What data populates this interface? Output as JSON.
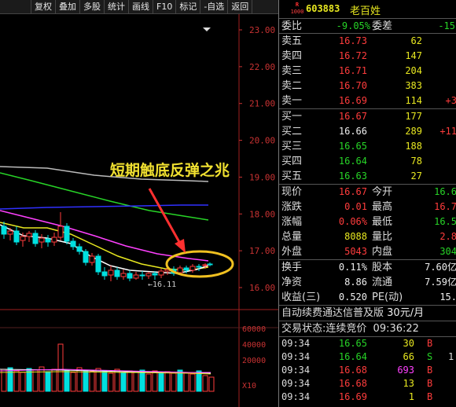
{
  "toolbar": {
    "items": [
      "",
      "复权",
      "叠加",
      "多股",
      "统计",
      "画线",
      "F10",
      "标记",
      "-自选",
      "返回"
    ]
  },
  "chart": {
    "price_axis": [
      "23.00",
      "22.00",
      "21.00",
      "20.00",
      "19.00",
      "18.00",
      "17.00",
      "16.00"
    ],
    "volume_axis": [
      "60000",
      "40000",
      "20000"
    ],
    "volume_multiplier": "X10",
    "low_marker": "←16.11",
    "annotation": "短期触底反弹之兆",
    "colors": {
      "up": "#ff3c3c",
      "down": "#00e0e0",
      "ma5": "#ffffff",
      "ma10": "#e8e820",
      "ma20": "#ff40ff",
      "ma30": "#27d427",
      "ma60": "#3030ff",
      "ma120": "#bbbbbb",
      "circle": "#f0c020",
      "arrow": "#ff3030"
    }
  },
  "stock": {
    "badge_top": "R",
    "badge_bottom": "1000",
    "code": "603883",
    "name": "老百姓"
  },
  "quote": {
    "weibi_label": "委比",
    "weibi_value": "-9.05%",
    "weicha_label": "委差",
    "weicha_value": "-15",
    "asks": [
      {
        "label": "卖五",
        "price": "16.73",
        "vol": "62",
        "chg": ""
      },
      {
        "label": "卖四",
        "price": "16.72",
        "vol": "147",
        "chg": ""
      },
      {
        "label": "卖三",
        "price": "16.71",
        "vol": "204",
        "chg": ""
      },
      {
        "label": "卖二",
        "price": "16.70",
        "vol": "383",
        "chg": ""
      },
      {
        "label": "卖一",
        "price": "16.69",
        "vol": "114",
        "chg": "+3"
      }
    ],
    "bids": [
      {
        "label": "买一",
        "price": "16.67",
        "vol": "177",
        "chg": ""
      },
      {
        "label": "买二",
        "price": "16.66",
        "vol": "289",
        "chg": "+11"
      },
      {
        "label": "买三",
        "price": "16.65",
        "vol": "188",
        "chg": ""
      },
      {
        "label": "买四",
        "price": "16.64",
        "vol": "78",
        "chg": ""
      },
      {
        "label": "买五",
        "price": "16.63",
        "vol": "27",
        "chg": ""
      }
    ],
    "stats": [
      {
        "l1": "现价",
        "v1": "16.67",
        "l2": "今开",
        "v2": "16.6"
      },
      {
        "l1": "涨跌",
        "v1": "0.01",
        "l2": "最高",
        "v2": "16.7"
      },
      {
        "l1": "涨幅",
        "v1": "0.06%",
        "l2": "最低",
        "v2": "16.5"
      },
      {
        "l1": "总量",
        "v1": "8088",
        "l2": "量比",
        "v2": "2.8"
      },
      {
        "l1": "外盘",
        "v1": "5043",
        "l2": "内盘",
        "v2": "304"
      }
    ],
    "fin": [
      {
        "l1": "换手",
        "v1": "0.11%",
        "l2": "股本",
        "v2": "7.60亿"
      },
      {
        "l1": "净资",
        "v1": "8.86",
        "l2": "流通",
        "v2": "7.59亿"
      },
      {
        "l1": "收益(三)",
        "v1": "0.520",
        "l2": "PE(动)",
        "v2": "15."
      }
    ]
  },
  "promo": {
    "text": "自动续费通达信普及版",
    "price": "30元/月"
  },
  "status": {
    "label": "交易状态:",
    "value": "连续竞价",
    "time": "09:36:22"
  },
  "trades": [
    {
      "time": "09:34",
      "price": "16.65",
      "vol": "30",
      "side": "B",
      "extra": ""
    },
    {
      "time": "09:34",
      "price": "16.64",
      "vol": "66",
      "side": "S",
      "extra": "1"
    },
    {
      "time": "09:34",
      "price": "16.68",
      "vol": "693",
      "side": "B",
      "extra": ""
    },
    {
      "time": "09:34",
      "price": "16.68",
      "vol": "13",
      "side": "B",
      "extra": ""
    },
    {
      "time": "09:34",
      "price": "16.69",
      "vol": "1",
      "side": "B",
      "extra": ""
    }
  ]
}
